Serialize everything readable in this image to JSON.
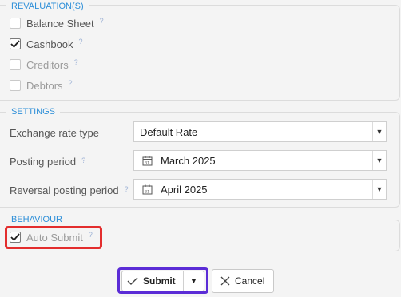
{
  "revaluations": {
    "legend": "REVALUATION(S)",
    "items": [
      {
        "label": "Balance Sheet",
        "checked": false,
        "help": "?"
      },
      {
        "label": "Cashbook",
        "checked": true,
        "help": "?"
      },
      {
        "label": "Creditors",
        "checked": false,
        "help": "?"
      },
      {
        "label": "Debtors",
        "checked": false,
        "help": "?"
      }
    ]
  },
  "settings": {
    "legend": "SETTINGS",
    "exchange_rate_type": {
      "label": "Exchange rate type",
      "value": "Default Rate"
    },
    "posting_period": {
      "label": "Posting period",
      "help": "?",
      "value": "March 2025"
    },
    "reversal_posting_period": {
      "label": "Reversal posting period",
      "help": "?",
      "value": "April 2025"
    }
  },
  "behaviour": {
    "legend": "BEHAVIOUR",
    "auto_submit": {
      "label": "Auto Submit",
      "checked": true,
      "help": "?"
    }
  },
  "footer": {
    "submit_label": "Submit",
    "cancel_label": "Cancel"
  },
  "colors": {
    "accent": "#2e8fd8",
    "highlight_red": "#e32d2d",
    "highlight_purple": "#5b2cd6"
  }
}
